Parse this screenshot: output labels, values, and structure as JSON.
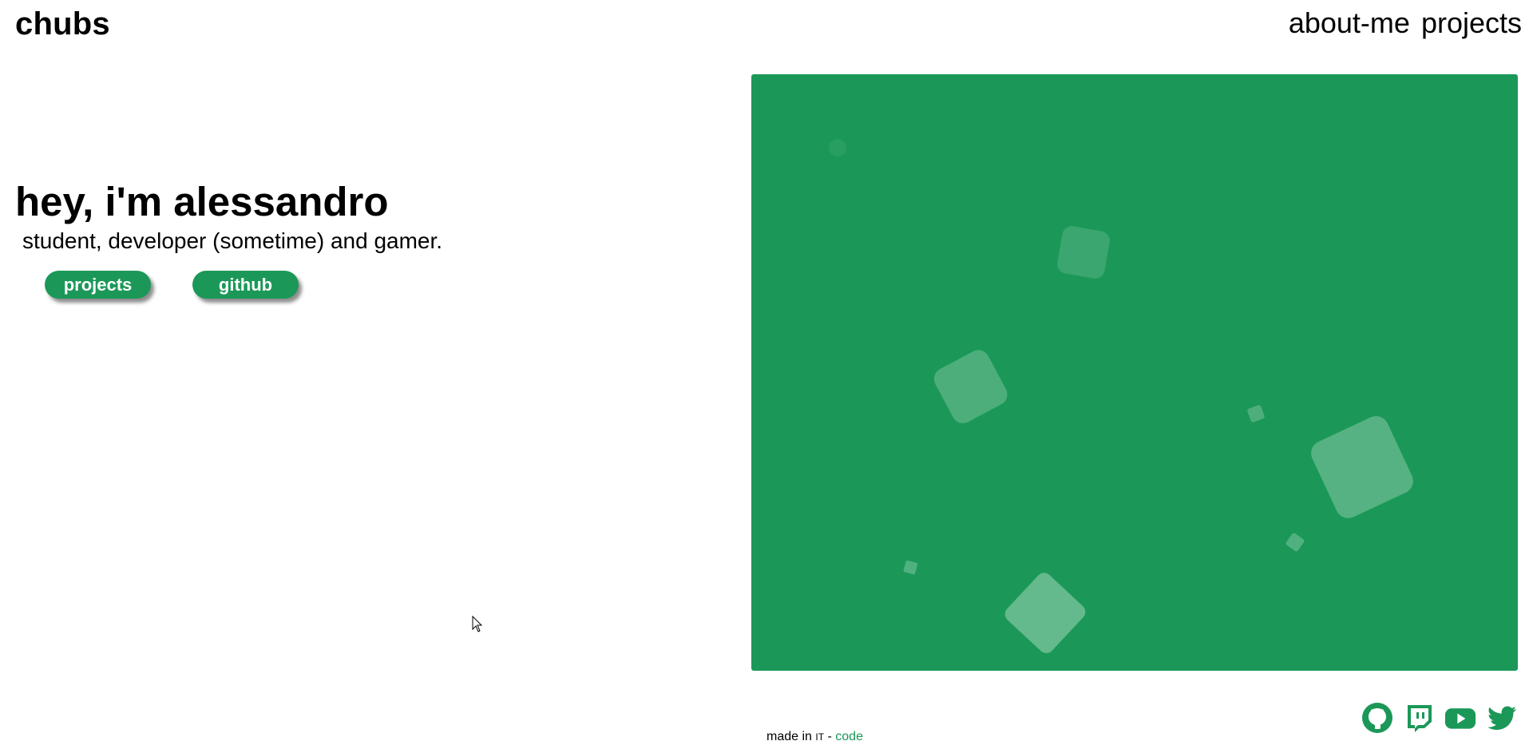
{
  "header": {
    "brand": "chubs",
    "nav": [
      {
        "label": "about-me"
      },
      {
        "label": "projects"
      }
    ]
  },
  "hero": {
    "title": "hey, i'm alessandro",
    "subtitle": "student, developer (sometime) and gamer.",
    "buttons": [
      {
        "label": "projects"
      },
      {
        "label": "github"
      }
    ]
  },
  "footer": {
    "made_in": "made in",
    "country": "IT",
    "separator": "-",
    "code_link": "code"
  },
  "socials": [
    {
      "icon": "github-icon"
    },
    {
      "icon": "twitch-icon"
    },
    {
      "icon": "youtube-icon"
    },
    {
      "icon": "twitter-icon"
    }
  ],
  "colors": {
    "accent": "#1b9858",
    "background": "#ffffff",
    "text": "#000000"
  }
}
